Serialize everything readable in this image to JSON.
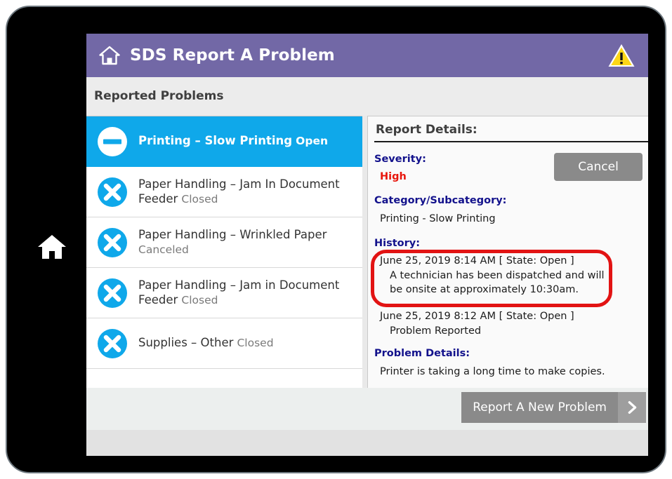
{
  "device": {
    "home_key_icon": "home-icon"
  },
  "app": {
    "title": "SDS Report A Problem",
    "title_home_icon": "home-icon",
    "warning_icon": "warning-triangle-icon",
    "header_color": "#7268a6"
  },
  "subheader": {
    "title": "Reported Problems"
  },
  "problem_list": {
    "items": [
      {
        "title": "Printing – Slow Printing",
        "status": "Open",
        "icon": "minus-circle-icon",
        "selected": true
      },
      {
        "title": "Paper Handling – Jam In Document Feeder",
        "status": "Closed",
        "icon": "x-circle-icon",
        "selected": false
      },
      {
        "title": "Paper Handling – Wrinkled Paper",
        "status": "Canceled",
        "icon": "x-circle-icon",
        "selected": false
      },
      {
        "title": "Paper Handling – Jam in Document Feeder",
        "status": "Closed",
        "icon": "x-circle-icon",
        "selected": false
      },
      {
        "title": "Supplies – Other",
        "status": "Closed",
        "icon": "x-circle-icon",
        "selected": false
      }
    ],
    "selected_color": "#0fa8ea"
  },
  "details": {
    "heading": "Report Details:",
    "cancel_label": "Cancel",
    "severity_label": "Severity:",
    "severity_value": "High",
    "severity_color": "#e8160c",
    "category_label": "Category/Subcategory:",
    "category_value": "Printing - Slow Printing",
    "history_label": "History:",
    "history": [
      {
        "stamp": "June 25, 2019 8:14 AM  [ State: Open ]",
        "note": "A technician has been dispatched and will be onsite at approximately 10:30am.",
        "highlighted": true
      },
      {
        "stamp": "June 25, 2019 8:12 AM  [ State: Open ]",
        "note": "Problem Reported",
        "highlighted": false
      }
    ],
    "problem_label": "Problem Details:",
    "problem_value": "Printer is taking a long time to make copies.",
    "label_color": "#13128c",
    "annotation_color": "#e21313"
  },
  "actions": {
    "report_new_label": "Report A New Problem",
    "report_new_chevron_icon": "chevron-right-icon"
  }
}
